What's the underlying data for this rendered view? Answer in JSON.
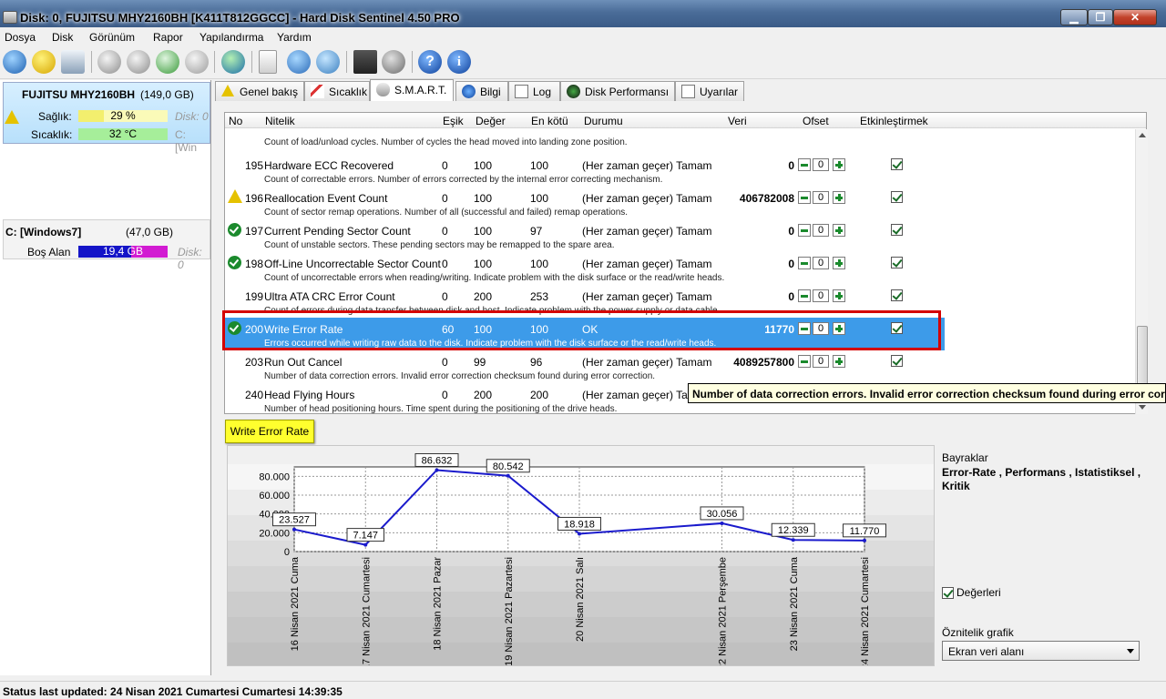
{
  "window": {
    "title": "Disk:  0, FUJITSU MHY2160BH [K411T812GGCC]  -  Hard Disk Sentinel  4.50 PRO"
  },
  "menu": [
    "Dosya",
    "Disk",
    "Görünüm",
    "Rapor",
    "Yapılandırma",
    "Yardım"
  ],
  "toolbar_icons": [
    "refresh-icon",
    "warning-icon",
    "disk-icon",
    "tool-1-icon",
    "tool-2-icon",
    "tool-3-icon",
    "tool-4-icon",
    "globe-icon",
    "report-icon",
    "sync-icon",
    "network-icon",
    "monitor-icon",
    "sound-icon",
    "help-icon",
    "info-icon"
  ],
  "left": {
    "disk_name": "FUJITSU MHY2160BH",
    "disk_size": "(149,0 GB)",
    "health_label": "Sağlık:",
    "health_value": "29 %",
    "health_pct": 29,
    "health_disk": "Disk: 0",
    "temp_label": "Sıcaklık:",
    "temp_value": "32 °C",
    "temp_drive": "C: [Win",
    "volume_name": "C: [Windows7]",
    "volume_size": "(47,0 GB)",
    "free_label": "Boş Alan",
    "free_value": "19,4 GB",
    "free_disk": "Disk: 0"
  },
  "tabs": [
    "Genel bakış",
    "Sıcaklık",
    "S.M.A.R.T.",
    "Bilgi",
    "Log",
    "Disk Performansı",
    "Uyarılar"
  ],
  "table": {
    "headers": [
      "No",
      "Nitelik",
      "Eşik",
      "Değer",
      "En kötü",
      "Durumu",
      "Veri",
      "Ofset",
      "Etkinleştirmek"
    ],
    "partial_row_desc": "Count of load/unload cycles. Number of cycles the head moved into landing zone position.",
    "rows": [
      {
        "no": "195",
        "name": "Hardware ECC Recovered",
        "thr": "0",
        "val": "100",
        "worst": "100",
        "status": "(Her zaman geçer) Tamam",
        "data": "0",
        "offset": "0",
        "desc": "Count of correctable errors. Number of errors corrected by the internal error correcting mechanism.",
        "icon": ""
      },
      {
        "no": "196",
        "name": "Reallocation Event Count",
        "thr": "0",
        "val": "100",
        "worst": "100",
        "status": "(Her zaman geçer) Tamam",
        "data": "406782008",
        "offset": "0",
        "desc": "Count of sector remap operations. Number of all (successful and failed) remap operations.",
        "icon": "warn"
      },
      {
        "no": "197",
        "name": "Current Pending Sector Count",
        "thr": "0",
        "val": "100",
        "worst": "97",
        "status": "(Her zaman geçer) Tamam",
        "data": "0",
        "offset": "0",
        "desc": "Count of unstable sectors. These pending sectors may be remapped to the spare area.",
        "icon": "ok"
      },
      {
        "no": "198",
        "name": "Off-Line Uncorrectable Sector Count",
        "thr": "0",
        "val": "100",
        "worst": "100",
        "status": "(Her zaman geçer) Tamam",
        "data": "0",
        "offset": "0",
        "desc": "Count of uncorrectable errors when reading/writing. Indicate problem with the disk surface or the read/write heads.",
        "icon": "ok"
      },
      {
        "no": "199",
        "name": "Ultra ATA CRC Error Count",
        "thr": "0",
        "val": "200",
        "worst": "253",
        "status": "(Her zaman geçer) Tamam",
        "data": "0",
        "offset": "0",
        "desc": "Count of errors during data transfer between disk and host. Indicate problem with the power supply or data cable.",
        "icon": ""
      },
      {
        "no": "200",
        "name": "Write Error Rate",
        "thr": "60",
        "val": "100",
        "worst": "100",
        "status": "OK",
        "data": "11770",
        "offset": "0",
        "desc": "Errors occurred while writing raw data to the disk. Indicate problem with the disk surface or the read/write heads.",
        "icon": "ok",
        "selected": true
      },
      {
        "no": "203",
        "name": "Run Out Cancel",
        "thr": "0",
        "val": "99",
        "worst": "96",
        "status": "(Her zaman geçer) Tamam",
        "data": "4089257800",
        "offset": "0",
        "desc": "Number of data correction errors. Invalid error correction checksum found during error correction.",
        "icon": ""
      },
      {
        "no": "240",
        "name": "Head Flying Hours",
        "thr": "0",
        "val": "200",
        "worst": "200",
        "status": "(Her zaman geçer) Tam",
        "data": "",
        "offset": "",
        "desc": "Number of head positioning hours. Time spent during the positioning of the drive heads.",
        "icon": ""
      }
    ]
  },
  "tooltip": "Number of data correction errors. Invalid error correction checksum found during error correction.",
  "chart_caption": "Write Error Rate",
  "chart_data": {
    "type": "line",
    "title": "Write Error Rate",
    "x": [
      "16 Nisan 2021 Cuma",
      "17 Nisan 2021 Cumartesi",
      "18 Nisan 2021 Pazar",
      "19 Nisan 2021 Pazartesi",
      "20 Nisan 2021 Salı",
      "22 Nisan 2021 Perşembe",
      "23 Nisan 2021 Cuma",
      "24 Nisan 2021 Cumartesi"
    ],
    "x_days": [
      16,
      17,
      18,
      19,
      20,
      22,
      23,
      24
    ],
    "values": [
      23527,
      7147,
      86632,
      80542,
      18918,
      30056,
      12339,
      11770
    ],
    "value_labels": [
      "23.527",
      "7.147",
      "86.632",
      "80.542",
      "18.918",
      "30.056",
      "12.339",
      "11.770"
    ],
    "yticks": [
      "0",
      "20.000",
      "40.000",
      "60.000",
      "80.000"
    ],
    "ytick_values": [
      0,
      20000,
      40000,
      60000,
      80000
    ],
    "ylim": [
      0,
      90000
    ],
    "grid": true,
    "line_color": "#1a1acc"
  },
  "right_panel": {
    "flags_label": "Bayraklar",
    "flags_value": "Error-Rate , Performans , Istatistiksel , Kritik",
    "show_values_label": "Değerleri",
    "graph_label": "Öznitelik grafik",
    "graph_select": "Ekran veri alanı"
  },
  "status": "Status last updated: 24 Nisan 2021 Cumartesi Cumartesi 14:39:35"
}
